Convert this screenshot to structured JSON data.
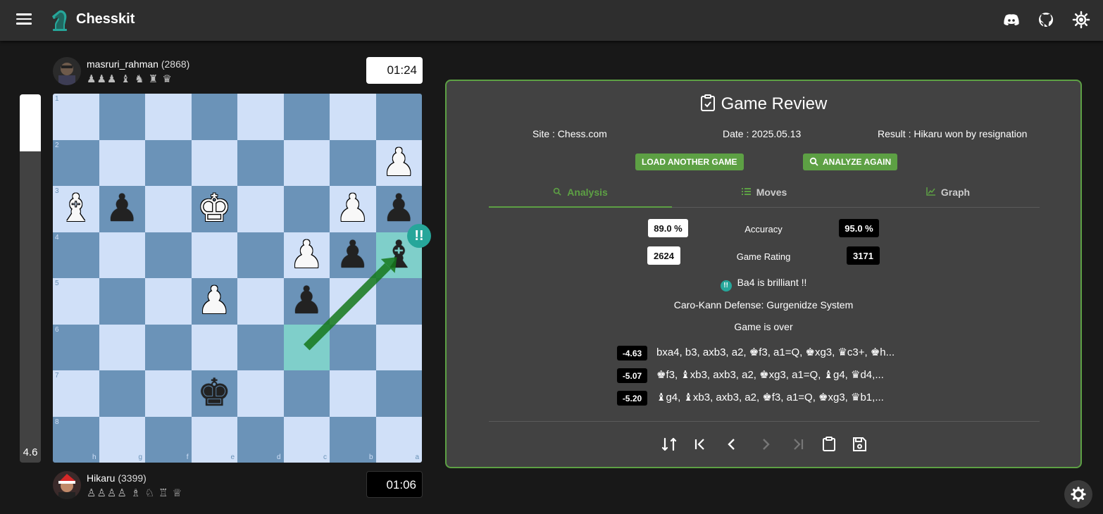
{
  "app": {
    "title": "Chesskit"
  },
  "eval_bar": {
    "value_label": "4.6",
    "white_fraction": 0.155
  },
  "top_player": {
    "name": "masruri_rahman",
    "rating": "(2868)",
    "captured": "♟♟♟ ♝ ♞ ♜ ♛",
    "clock": "01:24"
  },
  "bottom_player": {
    "name": "Hikaru",
    "rating": "(3399)",
    "captured": "♙♙♙♙ ♗ ♘ ♖ ♕",
    "clock": "01:06"
  },
  "board": {
    "rank_labels": [
      "1",
      "2",
      "3",
      "4",
      "5",
      "6",
      "7",
      "8"
    ],
    "file_labels": [
      "h",
      "g",
      "f",
      "e",
      "d",
      "c",
      "b",
      "a"
    ],
    "pieces": [
      {
        "row": 1,
        "col": 7,
        "color": "w",
        "glyph": "♟"
      },
      {
        "row": 2,
        "col": 0,
        "color": "w",
        "glyph": "♝"
      },
      {
        "row": 2,
        "col": 1,
        "color": "b",
        "glyph": "♟"
      },
      {
        "row": 2,
        "col": 3,
        "color": "w",
        "glyph": "♚"
      },
      {
        "row": 2,
        "col": 6,
        "color": "w",
        "glyph": "♟"
      },
      {
        "row": 2,
        "col": 7,
        "color": "b",
        "glyph": "♟"
      },
      {
        "row": 3,
        "col": 5,
        "color": "w",
        "glyph": "♟"
      },
      {
        "row": 3,
        "col": 6,
        "color": "b",
        "glyph": "♟"
      },
      {
        "row": 3,
        "col": 7,
        "color": "b",
        "glyph": "♝"
      },
      {
        "row": 4,
        "col": 3,
        "color": "w",
        "glyph": "♟"
      },
      {
        "row": 4,
        "col": 5,
        "color": "b",
        "glyph": "♟"
      },
      {
        "row": 6,
        "col": 3,
        "color": "b",
        "glyph": "♚"
      }
    ],
    "highlight_squares": [
      {
        "row": 3,
        "col": 7
      },
      {
        "row": 5,
        "col": 5
      }
    ],
    "arrow": {
      "from": {
        "row": 5,
        "col": 5
      },
      "to": {
        "row": 3,
        "col": 7
      },
      "color": "#15781b"
    },
    "badge_text": "!!"
  },
  "review": {
    "title": "Game Review",
    "site": "Site : Chess.com",
    "date": "Date : 2025.05.13",
    "result": "Result : Hikaru won by resignation",
    "load_button": "LOAD ANOTHER GAME",
    "analyze_button": "ANALYZE AGAIN",
    "tabs": [
      {
        "label": "Analysis",
        "icon": "search-icon"
      },
      {
        "label": "Moves",
        "icon": "list-icon"
      },
      {
        "label": "Graph",
        "icon": "chart-icon"
      }
    ],
    "accuracy_label": "Accuracy",
    "accuracy_white": "89.0 %",
    "accuracy_black": "95.0 %",
    "rating_label": "Game Rating",
    "rating_white": "2624",
    "rating_black": "3171",
    "brilliant_icon": "!!",
    "brilliant_text": "Ba4 is brilliant !!",
    "opening": "Caro-Kann Defense: Gurgenidze System",
    "status": "Game is over",
    "lines": [
      {
        "eval": "-4.63",
        "moves": "bxa4, b3, axb3, a2, ♚f3, a1=Q, ♚xg3, ♛c3+, ♚h..."
      },
      {
        "eval": "-5.07",
        "moves": "♚f3, ♝xb3, axb3, a2, ♚xg3, a1=Q, ♝g4, ♛d4,..."
      },
      {
        "eval": "-5.20",
        "moves": "♝g4, ♝xb3, axb3, a2, ♚f3, a1=Q, ♚xg3, ♛b1,..."
      }
    ]
  },
  "colors": {
    "accent": "#5da044",
    "light_square": "#d0e0f8",
    "dark_square": "#6b93b8",
    "highlight": "#7fcfca",
    "brilliant": "#26a69a"
  }
}
